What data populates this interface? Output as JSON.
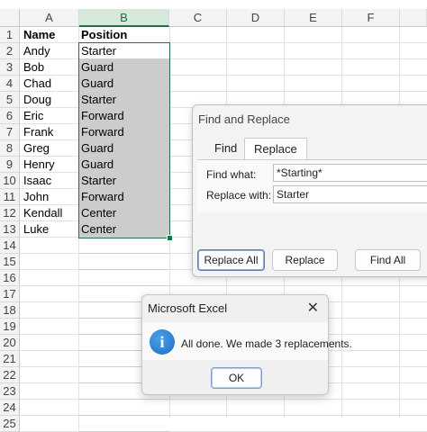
{
  "columns": [
    "A",
    "B",
    "C",
    "D",
    "E",
    "F"
  ],
  "rows": [
    "1",
    "2",
    "3",
    "4",
    "5",
    "6",
    "7",
    "8",
    "9",
    "10",
    "11",
    "12",
    "13",
    "14",
    "15",
    "16",
    "17",
    "18",
    "19",
    "20",
    "21",
    "22",
    "23",
    "24",
    "25"
  ],
  "table": [
    {
      "name": "Name",
      "position": "Position"
    },
    {
      "name": "Andy",
      "position": "Starter"
    },
    {
      "name": "Bob",
      "position": "Guard"
    },
    {
      "name": "Chad",
      "position": "Guard"
    },
    {
      "name": "Doug",
      "position": "Starter"
    },
    {
      "name": "Eric",
      "position": "Forward"
    },
    {
      "name": "Frank",
      "position": "Forward"
    },
    {
      "name": "Greg",
      "position": "Guard"
    },
    {
      "name": "Henry",
      "position": "Guard"
    },
    {
      "name": "Isaac",
      "position": "Starter"
    },
    {
      "name": "John",
      "position": "Forward"
    },
    {
      "name": "Kendall",
      "position": "Center"
    },
    {
      "name": "Luke",
      "position": "Center"
    }
  ],
  "find_replace": {
    "title": "Find and Replace",
    "tabs": [
      "Find",
      "Replace"
    ],
    "active_tab": "Replace",
    "find_what_label": "Find what:",
    "find_what_value": "*Starting*",
    "replace_with_label": "Replace with:",
    "replace_with_value": "Starter",
    "buttons": {
      "replace_all": "Replace All",
      "replace": "Replace",
      "find_all": "Find All"
    }
  },
  "message_box": {
    "title": "Microsoft Excel",
    "close_glyph": "✕",
    "icon": "info-icon",
    "icon_glyph": "i",
    "message": "All done. We made 3 replacements.",
    "ok_label": "OK"
  },
  "colors": {
    "selection_green": "#217346",
    "selected_fill": "#cccccc"
  }
}
